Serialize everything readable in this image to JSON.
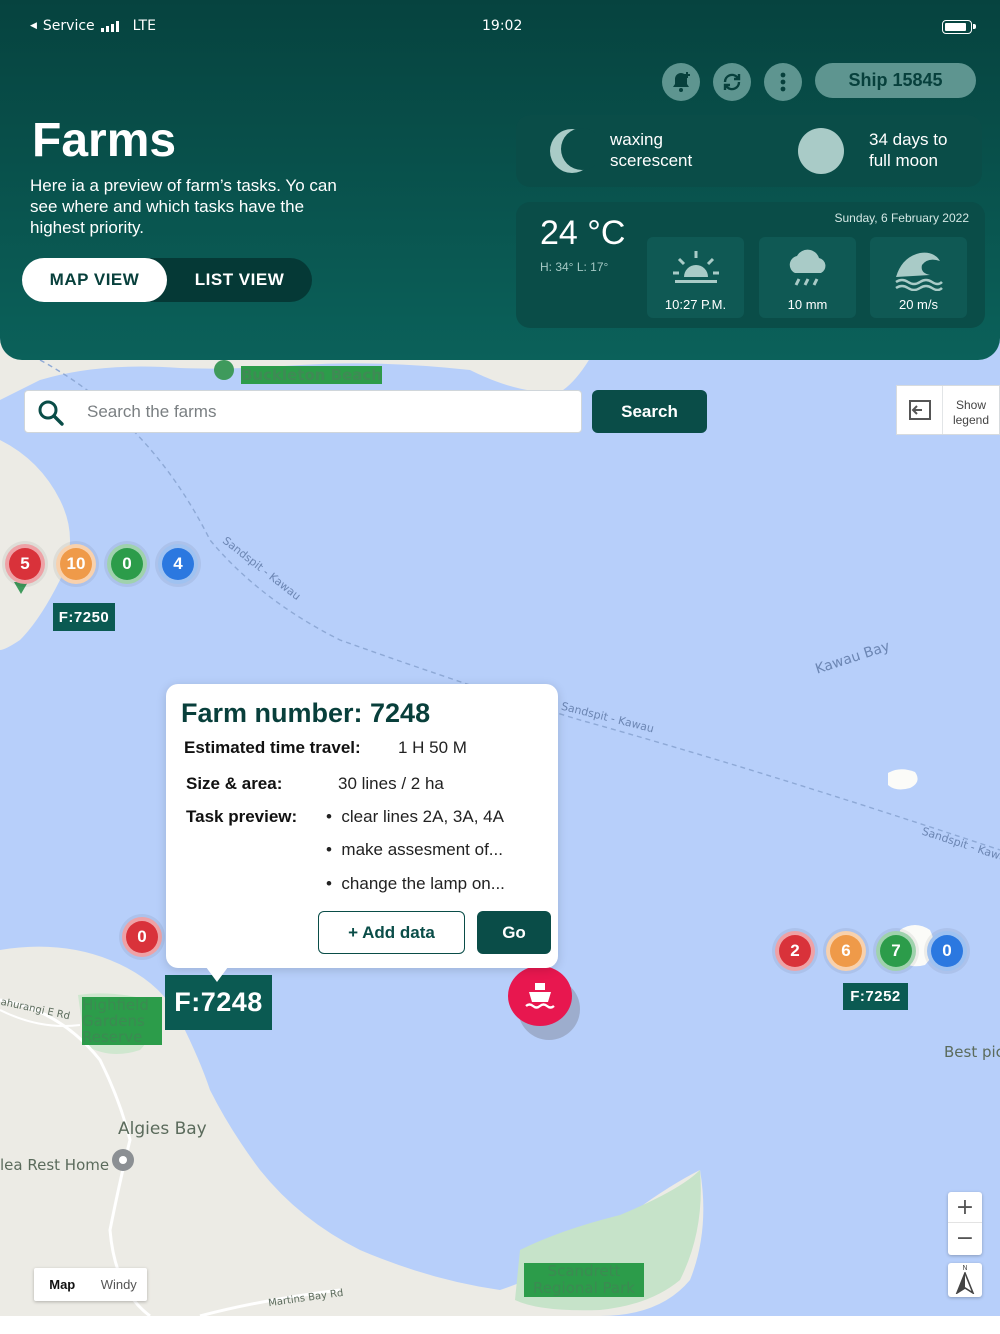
{
  "status_bar": {
    "carrier": "Service",
    "network": "LTE",
    "time": "19:02"
  },
  "header": {
    "title": "Farms",
    "description": "Here ia a preview of farm’s tasks. Yo can see where and which tasks have the highest priority.",
    "ship_label": "Ship 15845",
    "icons": [
      "bell-plus-icon",
      "sync-icon",
      "more-vertical-icon"
    ]
  },
  "view_toggle": {
    "map": "MAP VIEW",
    "list": "LIST VIEW",
    "selected": "MAP VIEW"
  },
  "moon": {
    "phase": "waxing scerescent",
    "countdown": "34 days to full moon"
  },
  "weather": {
    "temperature": "24 °C",
    "high_low": "H: 34° L: 17°",
    "date": "Sunday, 6 February 2022",
    "tiles": [
      {
        "icon": "sunset-icon",
        "value": "10:27 P.M."
      },
      {
        "icon": "rain-icon",
        "value": "10 mm"
      },
      {
        "icon": "wave-icon",
        "value": "20 m/s"
      }
    ]
  },
  "search": {
    "placeholder": "Search the farms",
    "button": "Search"
  },
  "legend": {
    "label": "Show legend"
  },
  "map": {
    "places": {
      "buckleton": "Buckleton Beach",
      "highfield": "Highfield Gardens Reserve",
      "algies": "Algies Bay",
      "rest_home": "lea Rest Home",
      "scandrett": "Scandrett Regional Park",
      "best_pic": "Best pic",
      "mahurangi": "ahurangi E Rd",
      "martins": "Martins Bay Rd"
    },
    "routes": {
      "r1": "Sandspit - Kawau",
      "r2": "Sandspit - Kawau",
      "r3": "Sandspit - Kawa"
    },
    "bay": "Kawau Bay",
    "type_map": "Map",
    "type_windy": "Windy",
    "zoom_in": "+",
    "zoom_out": "−",
    "compass_n": "N"
  },
  "farms": [
    {
      "tag": "F:7250",
      "counts": {
        "red": "5",
        "orange": "10",
        "green": "0",
        "blue": "4"
      }
    },
    {
      "tag": "F:7248",
      "counts": {
        "red": "0"
      }
    },
    {
      "tag": "F:7252",
      "counts": {
        "red": "2",
        "orange": "6",
        "green": "7",
        "blue": "0"
      }
    }
  ],
  "popup": {
    "title": "Farm number: 7248",
    "travel_label": "Estimated time travel:",
    "travel_value": "1 H 50 M",
    "size_label": "Size & area:",
    "size_value": "30 lines / 2 ha",
    "tasks_label": "Task preview:",
    "tasks": [
      "clear lines 2A, 3A, 4A",
      "make assesment of...",
      "change the lamp on..."
    ],
    "add_button": "+ Add data",
    "go_button": "Go"
  },
  "colors": {
    "header": "#0b615a",
    "accent": "#0a4d48",
    "ship_marker": "#e8174f"
  }
}
